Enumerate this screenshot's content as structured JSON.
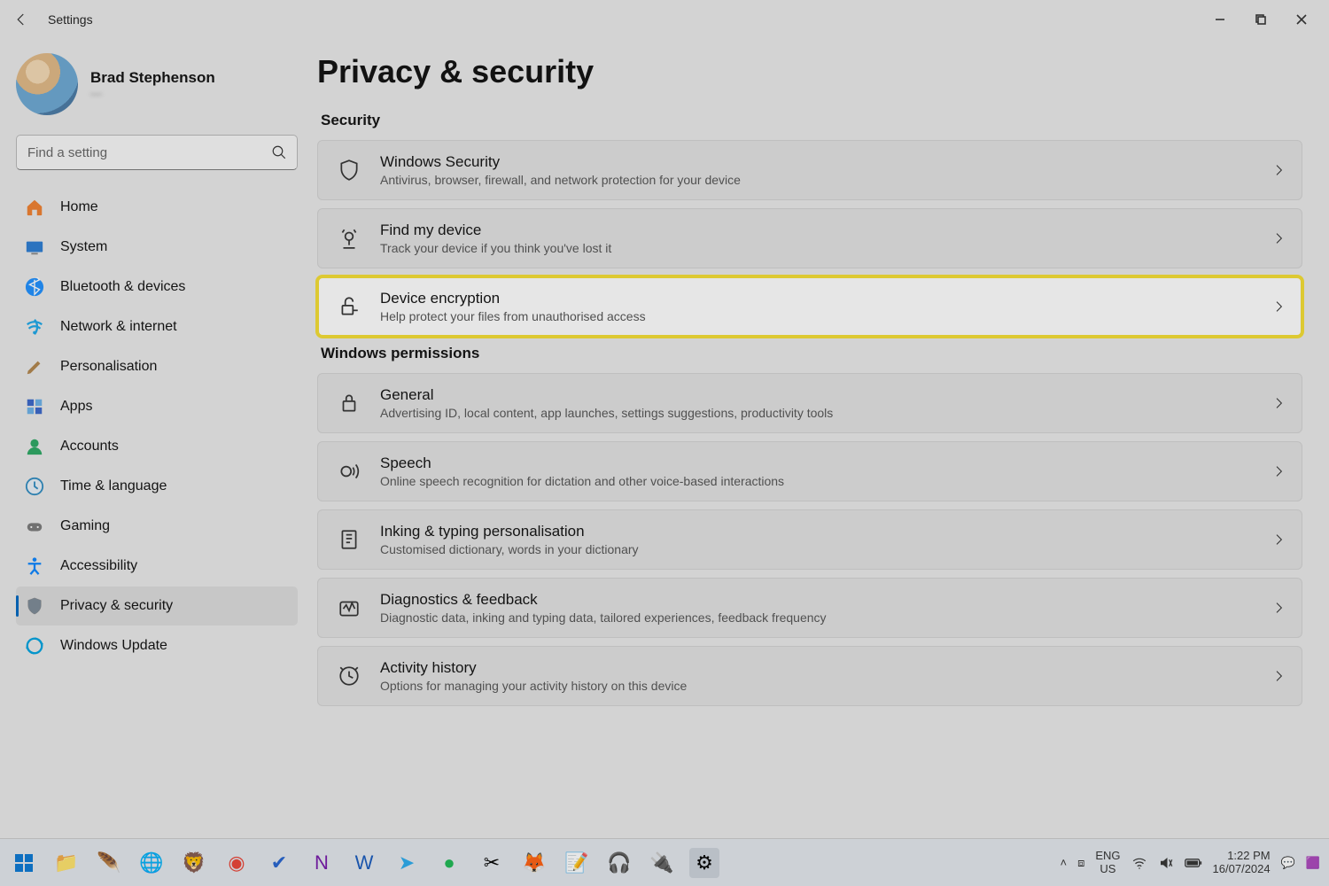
{
  "window": {
    "app_name": "Settings"
  },
  "profile": {
    "name": "Brad Stephenson",
    "email": "—"
  },
  "search": {
    "placeholder": "Find a setting"
  },
  "nav": [
    {
      "id": "home",
      "label": "Home",
      "color": "#f08030"
    },
    {
      "id": "system",
      "label": "System",
      "color": "#2b7cd3"
    },
    {
      "id": "bluetooth",
      "label": "Bluetooth & devices",
      "color": "#1e90ff"
    },
    {
      "id": "network",
      "label": "Network & internet",
      "color": "#1ca8e8"
    },
    {
      "id": "personalisation",
      "label": "Personalisation",
      "color": "#b2864d"
    },
    {
      "id": "apps",
      "label": "Apps",
      "color": "#3a67c9"
    },
    {
      "id": "accounts",
      "label": "Accounts",
      "color": "#2ca864"
    },
    {
      "id": "time",
      "label": "Time & language",
      "color": "#2e8bc0"
    },
    {
      "id": "gaming",
      "label": "Gaming",
      "color": "#7a7a7a"
    },
    {
      "id": "accessibility",
      "label": "Accessibility",
      "color": "#0a84ff"
    },
    {
      "id": "privacy",
      "label": "Privacy & security",
      "color": "#7c8a97",
      "active": true
    },
    {
      "id": "update",
      "label": "Windows Update",
      "color": "#00a3e0"
    }
  ],
  "page": {
    "title": "Privacy & security",
    "sections": [
      {
        "heading": "Security",
        "items": [
          {
            "id": "windows-security",
            "title": "Windows Security",
            "sub": "Antivirus, browser, firewall, and network protection for your device"
          },
          {
            "id": "find-my-device",
            "title": "Find my device",
            "sub": "Track your device if you think you've lost it"
          },
          {
            "id": "device-encryption",
            "title": "Device encryption",
            "sub": "Help protect your files from unauthorised access",
            "highlight": true
          }
        ]
      },
      {
        "heading": "Windows permissions",
        "items": [
          {
            "id": "general",
            "title": "General",
            "sub": "Advertising ID, local content, app launches, settings suggestions, productivity tools"
          },
          {
            "id": "speech",
            "title": "Speech",
            "sub": "Online speech recognition for dictation and other voice-based interactions"
          },
          {
            "id": "inking",
            "title": "Inking & typing personalisation",
            "sub": "Customised dictionary, words in your dictionary"
          },
          {
            "id": "diagnostics",
            "title": "Diagnostics & feedback",
            "sub": "Diagnostic data, inking and typing data, tailored experiences, feedback frequency"
          },
          {
            "id": "activity",
            "title": "Activity history",
            "sub": "Options for managing your activity history on this device"
          }
        ]
      }
    ]
  },
  "taskbar": {
    "lang_top": "ENG",
    "lang_bot": "US",
    "time": "1:22 PM",
    "date": "16/07/2024"
  }
}
